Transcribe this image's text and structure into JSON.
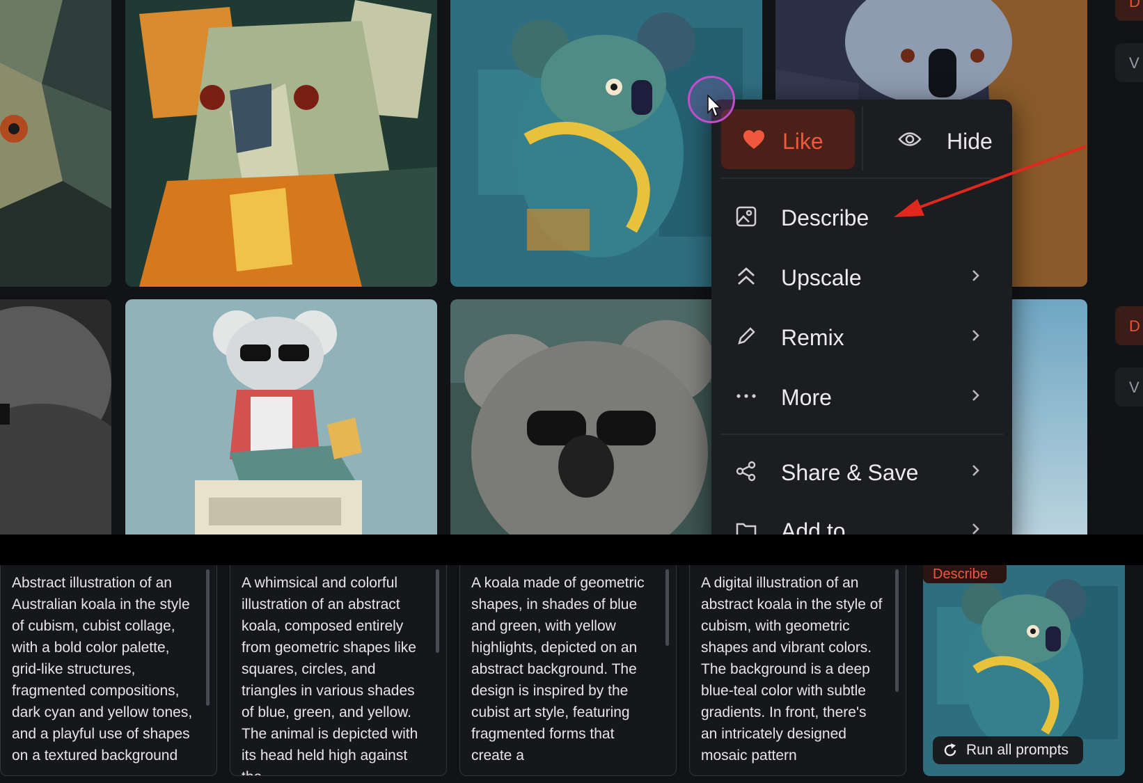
{
  "menu": {
    "like_label": "Like",
    "hide_label": "Hide",
    "items": [
      {
        "label": "Describe",
        "icon": "image-icon"
      },
      {
        "label": "Upscale",
        "icon": "double-chevron-up-icon"
      },
      {
        "label": "Remix",
        "icon": "pencil-icon"
      },
      {
        "label": "More",
        "icon": "ellipsis-icon"
      },
      {
        "label": "Share & Save",
        "icon": "share-icon"
      },
      {
        "label": "Add to",
        "icon": "folder-icon"
      }
    ]
  },
  "side_buttons": [
    "D",
    "V",
    "D",
    "V"
  ],
  "prompts": [
    "Abstract illustration of an Australian koala in the style of cubism, cubist collage, with a bold color palette, grid-like structures, fragmented compositions, dark cyan and yellow tones, and a playful use of shapes on a textured background",
    "A whimsical and colorful illustration of an abstract koala, composed entirely from geometric shapes like squares, circles, and triangles in various shades of blue, green, and yellow. The animal is depicted with its head held high against the",
    "A koala made of geometric shapes, in shades of blue and green, with yellow highlights, depicted on an abstract background. The design is inspired by the cubist art style, featuring fragmented forms that create a",
    "A digital illustration of an abstract koala in the style of cubism, with geometric shapes and vibrant colors. The background is a deep blue-teal color with subtle gradients. In front, there's an intricately designed mosaic pattern"
  ],
  "preview": {
    "tag": "Describe",
    "run_label": "Run all prompts"
  },
  "colors": {
    "accent": "#f0583d",
    "menu_bg": "#1c1d21",
    "page_bg": "#121316"
  }
}
